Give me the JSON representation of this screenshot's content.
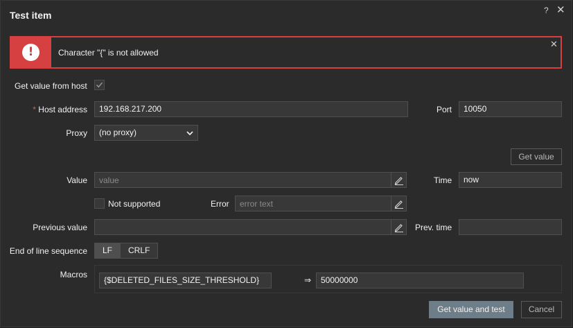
{
  "dialog": {
    "title": "Test item",
    "help_label": "?",
    "close_label": "✕"
  },
  "error": {
    "icon_label": "!",
    "message": "Character \"{\" is not allowed",
    "close_label": "✕"
  },
  "form": {
    "get_value_from_host": {
      "label": "Get value from host",
      "checked": true
    },
    "host_address": {
      "required_mark": "*",
      "label": "Host address",
      "value": "192.168.217.200"
    },
    "port": {
      "label": "Port",
      "value": "10050"
    },
    "proxy": {
      "label": "Proxy",
      "selected": "(no proxy)"
    },
    "get_value_button": "Get value",
    "value": {
      "label": "Value",
      "placeholder": "value"
    },
    "time": {
      "label": "Time",
      "value": "now"
    },
    "not_supported": {
      "label": "Not supported",
      "checked": false
    },
    "error_field": {
      "label": "Error",
      "placeholder": "error text"
    },
    "previous_value": {
      "label": "Previous value",
      "value": ""
    },
    "prev_time": {
      "label": "Prev. time",
      "value": ""
    },
    "eol": {
      "label": "End of line sequence",
      "options": [
        "LF",
        "CRLF"
      ],
      "selected": "LF"
    },
    "macros": {
      "label": "Macros",
      "name": "{$DELETED_FILES_SIZE_THRESHOLD}",
      "arrow": "⇒",
      "value": "50000000"
    }
  },
  "footer": {
    "primary_button": "Get value and test",
    "cancel_button": "Cancel"
  },
  "colors": {
    "background": "#2b2b2b",
    "error": "#d64040",
    "primary_button": "#6d7e88",
    "input_bg": "#383838",
    "required": "#e45959"
  },
  "icons": {
    "error": "exclamation-circle-icon",
    "edit": "pencil-icon",
    "check": "check-icon",
    "select": "chevron-down-icon"
  }
}
